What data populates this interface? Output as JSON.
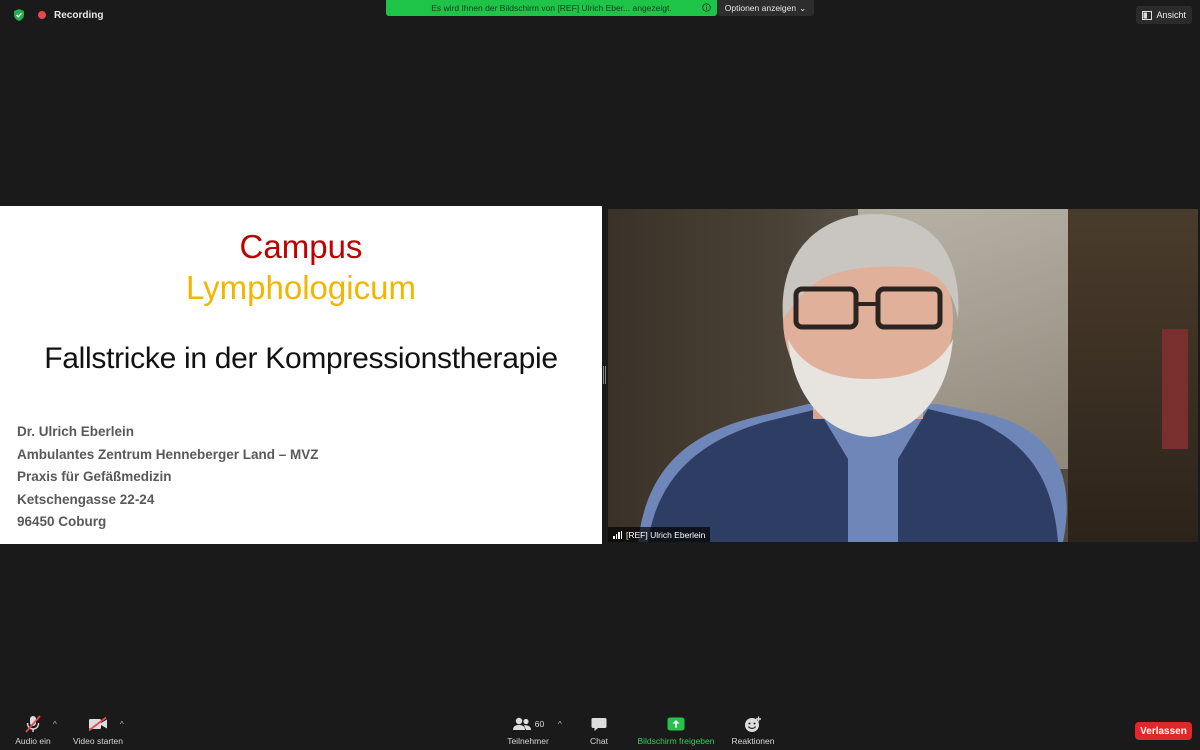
{
  "topbar": {
    "recording_label": "Recording",
    "share_banner": "Es wird Ihnen der Bildschirm von [REF] Ulrich Eber... angezeigt.",
    "options_label": "Optionen anzeigen",
    "view_label": "Ansicht"
  },
  "slide": {
    "title_line1": "Campus",
    "title_line2": "Lymphologicum",
    "subtitle": "Fallstricke in der Kompressionstherapie",
    "author": [
      "Dr. Ulrich Eberlein",
      "Ambulantes Zentrum Henneberger Land – MVZ",
      "Praxis für Gefäßmedizin",
      "Ketschengasse 22-24",
      "96450 Coburg"
    ]
  },
  "video": {
    "participant_name": "[REF] Ulrich Eberlein"
  },
  "toolbar": {
    "audio_label": "Audio ein",
    "video_label": "Video starten",
    "participants_label": "Teilnehmer",
    "participants_count": "60",
    "chat_label": "Chat",
    "share_label": "Bildschirm freigeben",
    "reactions_label": "Reaktionen",
    "leave_label": "Verlassen"
  },
  "colors": {
    "share_green": "#1ec448",
    "leave_red": "#e02828",
    "title_red": "#c00000",
    "title_yellow": "#f2b600"
  }
}
